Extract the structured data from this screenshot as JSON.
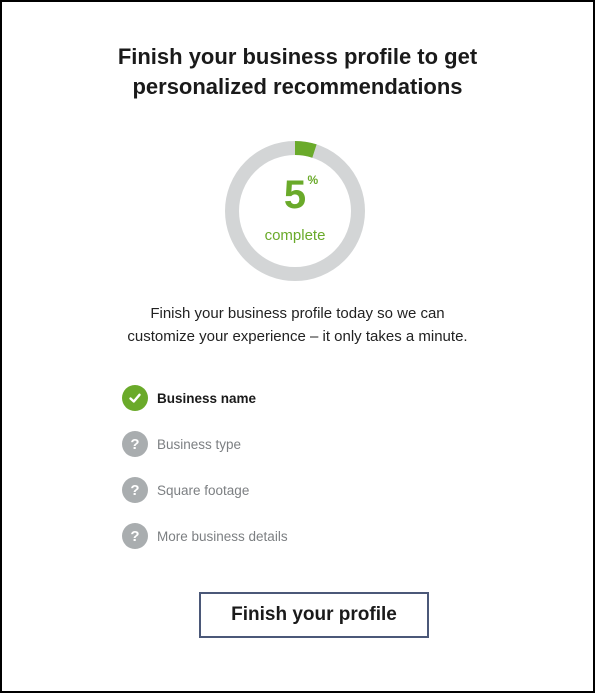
{
  "heading": {
    "line1": "Finish your business profile to get",
    "line2": "personalized recommendations"
  },
  "progress": {
    "percent": 5,
    "percent_display": "5",
    "percent_sign": "%",
    "label": "complete",
    "accent_color": "#6aaa2a",
    "track_color": "#d3d5d6"
  },
  "description": {
    "line1": "Finish your business profile today so we can",
    "line2": "customize your experience – it only takes a minute."
  },
  "checklist": [
    {
      "label": "Business name",
      "status": "complete",
      "icon": "checkmark-icon",
      "glyph": "✓"
    },
    {
      "label": "Business type",
      "status": "incomplete",
      "icon": "question-mark-icon",
      "glyph": "?"
    },
    {
      "label": "Square footage",
      "status": "incomplete",
      "icon": "question-mark-icon",
      "glyph": "?"
    },
    {
      "label": "More business details",
      "status": "incomplete",
      "icon": "question-mark-icon",
      "glyph": "?"
    }
  ],
  "cta": {
    "label": "Finish your profile",
    "border_color": "#4b5878"
  }
}
